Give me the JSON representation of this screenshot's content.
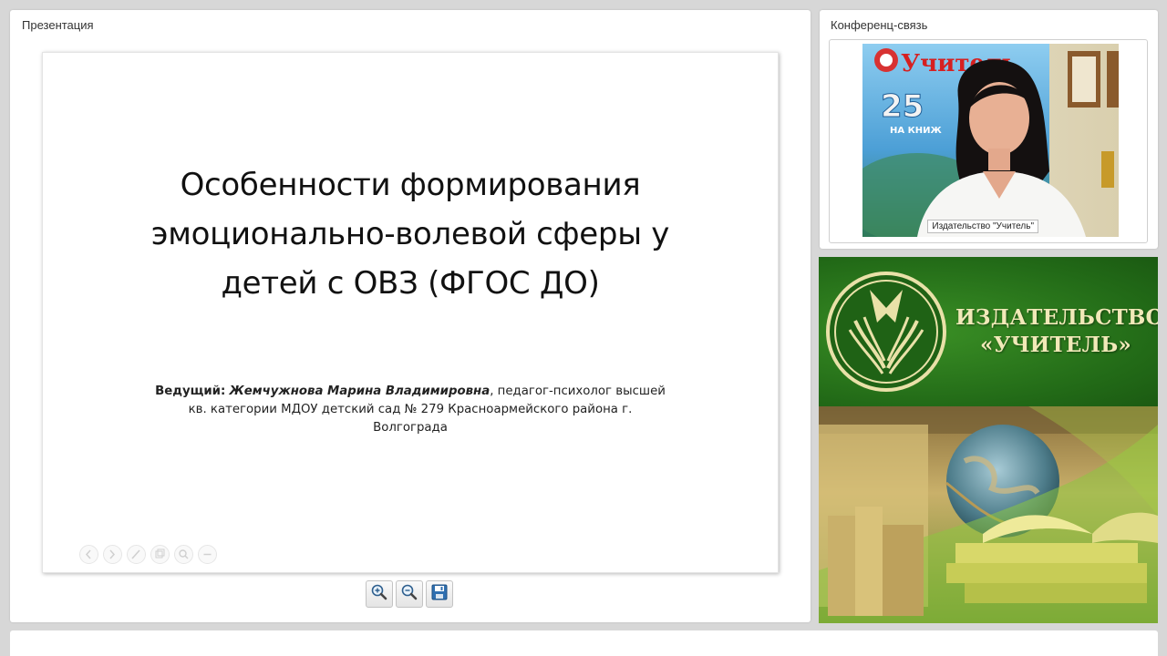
{
  "presentation": {
    "panel_title": "Презентация",
    "slide": {
      "title_lines": [
        "Особенности формирования",
        "эмоционально-волевой сферы у",
        "детей с ОВЗ (ФГОС ДО)"
      ],
      "presenter_label": "Ведущий:",
      "presenter_name": "Жемчужнова Марина Владимировна",
      "presenter_details_1": ", педагог-психолог высшей",
      "presenter_details_2": "кв. категории МДОУ детский сад № 279 Красноармейского района г.",
      "presenter_details_3": "Волгограда"
    },
    "slide_tools": [
      "prev-icon",
      "next-icon",
      "pen-icon",
      "copy-icon",
      "zoom-icon",
      "minus-icon"
    ],
    "toolbar": [
      "zoom-in-icon",
      "zoom-out-icon",
      "save-icon"
    ]
  },
  "conference": {
    "panel_title": "Конференц-связь",
    "video_caption": "Издательство \"Учитель\""
  },
  "banner": {
    "line1": "ИЗДАТЕЛЬСТВО",
    "line2": "«УЧИТЕЛЬ»",
    "poster_text": "Учитель",
    "poster_number": "25",
    "poster_sub": "НА КНИЖ"
  },
  "colors": {
    "banner_green": "#226a17",
    "banner_text": "#f1e9b8"
  }
}
